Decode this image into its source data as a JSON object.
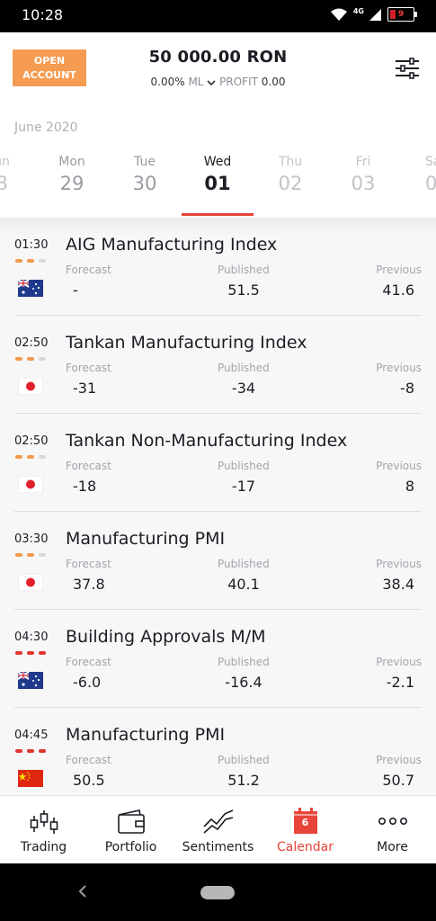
{
  "status_bar": {
    "time": "10:28",
    "network": "4G",
    "battery_level": "9"
  },
  "header": {
    "open_account_line1": "OPEN",
    "open_account_line2": "ACCOUNT",
    "balance": "50 000.00 RON",
    "ml_value": "0.00%",
    "ml_label": "ML",
    "profit_label": "PROFIT",
    "profit_value": "0.00",
    "settings_icon": "sliders-icon"
  },
  "calendar": {
    "month": "June 2020",
    "days": [
      {
        "name": "un",
        "num": "8"
      },
      {
        "name": "Mon",
        "num": "29"
      },
      {
        "name": "Tue",
        "num": "30"
      },
      {
        "name": "Wed",
        "num": "01"
      },
      {
        "name": "Thu",
        "num": "02"
      },
      {
        "name": "Fri",
        "num": "03"
      },
      {
        "name": "Sa",
        "num": "0"
      }
    ],
    "active_day_index": 3
  },
  "labels": {
    "forecast": "Forecast",
    "published": "Published",
    "previous": "Previous"
  },
  "events": [
    {
      "time": "01:30",
      "title": "AIG Manufacturing Index",
      "forecast": "-",
      "published": "51.5",
      "previous": "41.6",
      "impact": 2,
      "impact_color": "orange",
      "country": "australia"
    },
    {
      "time": "02:50",
      "title": "Tankan Manufacturing Index",
      "forecast": "-31",
      "published": "-34",
      "previous": "-8",
      "impact": 2,
      "impact_color": "orange",
      "country": "japan"
    },
    {
      "time": "02:50",
      "title": "Tankan Non-Manufacturing Index",
      "forecast": "-18",
      "published": "-17",
      "previous": "8",
      "impact": 2,
      "impact_color": "orange",
      "country": "japan"
    },
    {
      "time": "03:30",
      "title": "Manufacturing PMI",
      "forecast": "37.8",
      "published": "40.1",
      "previous": "38.4",
      "impact": 2,
      "impact_color": "orange",
      "country": "japan"
    },
    {
      "time": "04:30",
      "title": "Building Approvals M/M",
      "forecast": "-6.0",
      "published": "-16.4",
      "previous": "-2.1",
      "impact": 3,
      "impact_color": "red",
      "country": "australia"
    },
    {
      "time": "04:45",
      "title": "Manufacturing PMI",
      "forecast": "50.5",
      "published": "51.2",
      "previous": "50.7",
      "impact": 3,
      "impact_color": "red",
      "country": "china"
    }
  ],
  "bottom_nav": {
    "items": [
      {
        "label": "Trading",
        "icon": "candlestick-icon"
      },
      {
        "label": "Portfolio",
        "icon": "wallet-icon"
      },
      {
        "label": "Sentiments",
        "icon": "trend-lines-icon"
      },
      {
        "label": "Calendar",
        "icon": "calendar-icon",
        "badge": "6"
      },
      {
        "label": "More",
        "icon": "more-dots-icon"
      }
    ],
    "active_index": 3
  },
  "colors": {
    "accent": "#e8443a",
    "open_account": "#f59b52",
    "impact_orange": "#f39a4b",
    "impact_red": "#e0352e"
  }
}
